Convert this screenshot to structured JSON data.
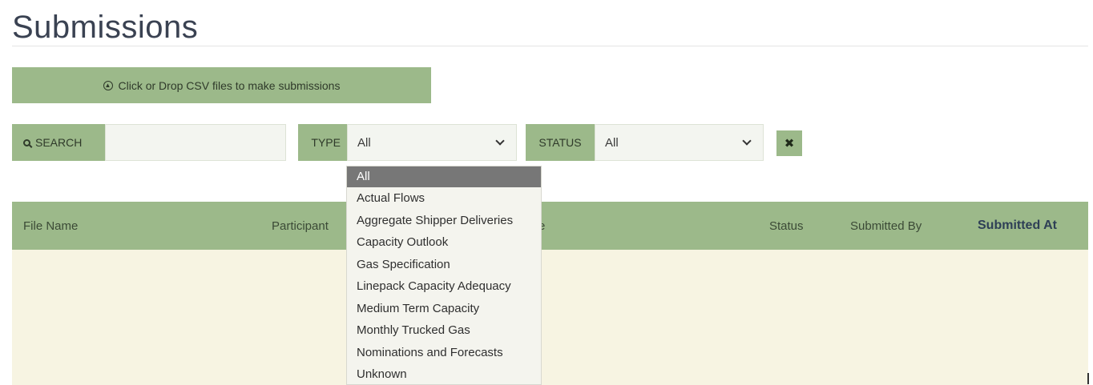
{
  "page": {
    "title": "Submissions"
  },
  "upload": {
    "icon": "upload-circle-icon",
    "label": "Click or Drop CSV files to make submissions"
  },
  "filters": {
    "search": {
      "label": "SEARCH",
      "icon": "search-icon",
      "value": ""
    },
    "type": {
      "label": "TYPE",
      "selected": "All",
      "options": [
        "All",
        "Actual Flows",
        "Aggregate Shipper Deliveries",
        "Capacity Outlook",
        "Gas Specification",
        "Linepack Capacity Adequacy",
        "Medium Term Capacity",
        "Monthly Trucked Gas",
        "Nominations and Forecasts",
        "Unknown"
      ]
    },
    "status": {
      "label": "STATUS",
      "selected": "All"
    },
    "clear": {
      "icon": "close-icon",
      "glyph": "✖"
    }
  },
  "table": {
    "columns": [
      "File Name",
      "Participant",
      "Type",
      "Status",
      "Submitted By",
      "Submitted At"
    ],
    "type_visible_fragment": "e",
    "rows": []
  },
  "colors": {
    "accent": "#9cb98a",
    "table_body": "#f7f4e2",
    "dropdown_selected": "#777777",
    "title": "#3a4252"
  }
}
